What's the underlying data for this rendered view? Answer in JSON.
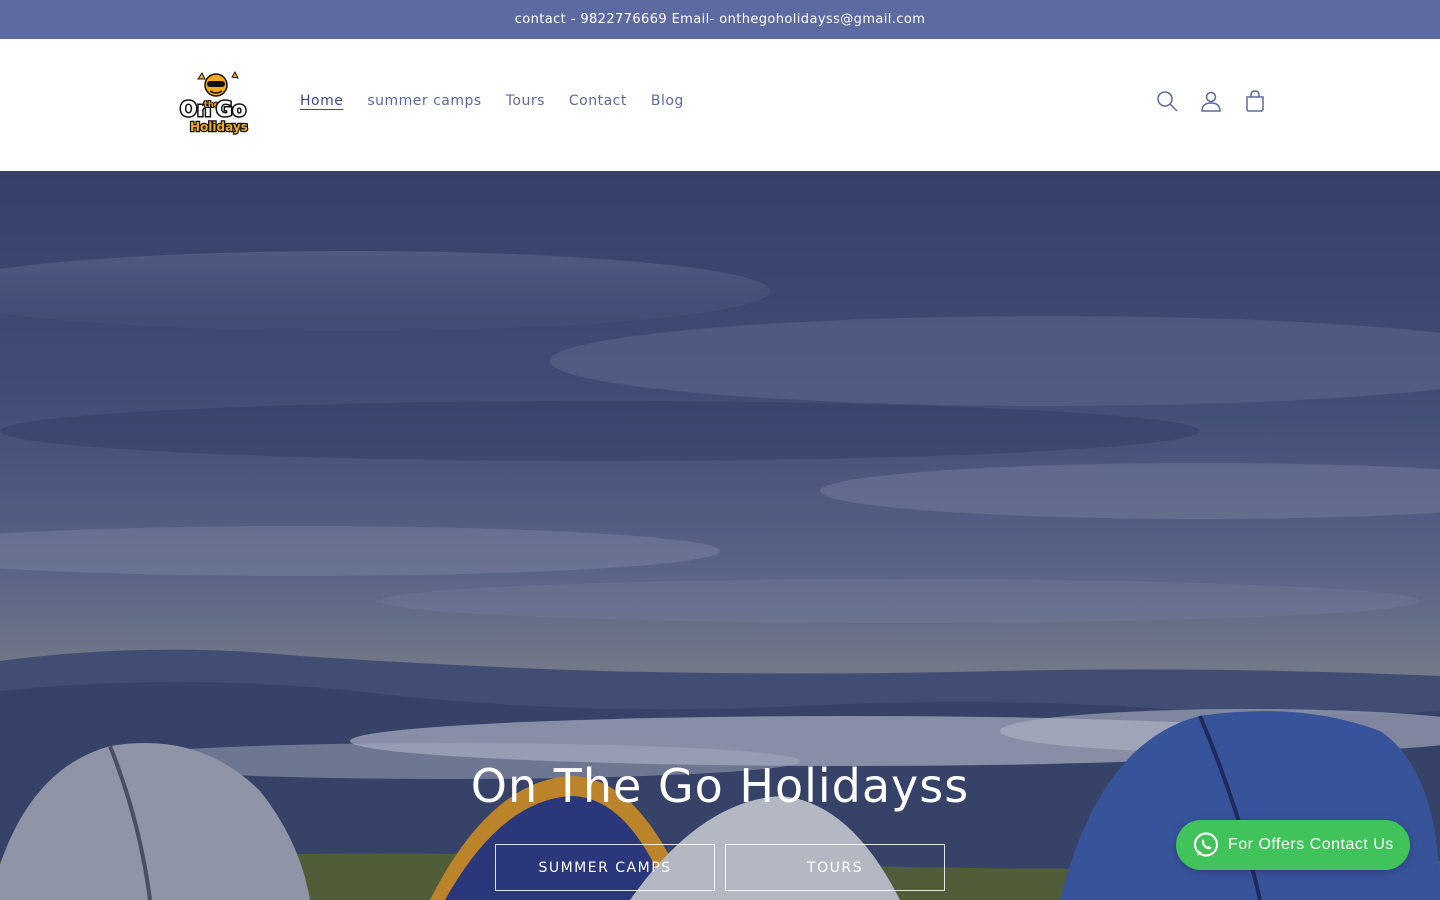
{
  "announcement": "contact - 9822776669 Email- onthegoholidayss@gmail.com",
  "logo": {
    "line1": "On",
    "line2": "the",
    "line3": "Go",
    "line4": "Holidays"
  },
  "nav": [
    {
      "label": "Home"
    },
    {
      "label": "summer camps"
    },
    {
      "label": "Tours"
    },
    {
      "label": "Contact"
    },
    {
      "label": "Blog"
    }
  ],
  "header_icons": [
    "search-icon",
    "account-icon",
    "cart-icon"
  ],
  "hero": {
    "title": "On The Go Holidayss",
    "buttons": [
      {
        "label": "SUMMER CAMPS"
      },
      {
        "label": "TOURS"
      }
    ]
  },
  "whatsapp": {
    "label": "For Offers Contact Us"
  },
  "colors": {
    "accent": "#5c6aa1",
    "whatsapp": "#3fc35a"
  }
}
